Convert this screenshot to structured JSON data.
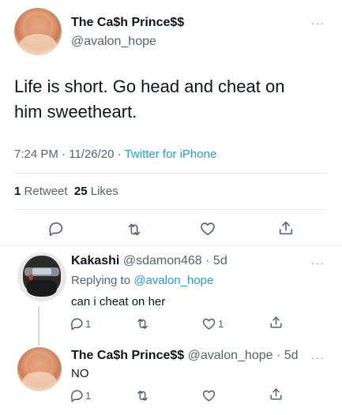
{
  "main_tweet": {
    "display_name": "The Ca$h Prince$$",
    "handle": "@avalon_hope",
    "text": "Life is short. Go head and cheat on him sweetheart.",
    "time": "7:24 PM",
    "sep1": "·",
    "date": "11/26/20",
    "sep2": "·",
    "source": "Twitter for iPhone",
    "retweets_count": "1",
    "retweets_label": "Retweet",
    "likes_count": "25",
    "likes_label": "Likes",
    "more": "···"
  },
  "replies": [
    {
      "display_name": "Kakashi",
      "handle": "@sdamon468",
      "dot": "·",
      "age": "5d",
      "replying_prefix": "Replying to",
      "replying_to": "@avalon_hope",
      "text": "can i cheat on her",
      "reply_count": "1",
      "like_count": "1",
      "more": "···"
    },
    {
      "display_name": "The Ca$h Prince$$",
      "handle": "@avalon_hope",
      "dot": "·",
      "age": "5d",
      "text": "NO",
      "reply_count": "1",
      "more": "···"
    }
  ],
  "colors": {
    "accent": "#1d9bf0",
    "secondary_text": "#536471",
    "icon": "#536471"
  },
  "icons": [
    "reply-icon",
    "retweet-icon",
    "like-icon",
    "share-icon",
    "more-icon"
  ]
}
